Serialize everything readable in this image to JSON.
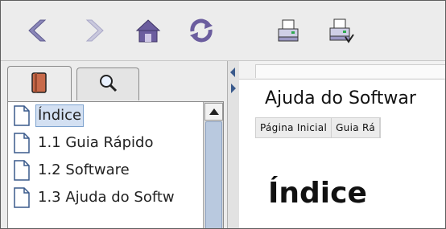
{
  "toolbar": {
    "icons": [
      "back-arrow-icon",
      "forward-arrow-icon",
      "home-icon",
      "sync-icon",
      "print-icon",
      "print-setup-icon"
    ]
  },
  "nav": {
    "tabs": [
      {
        "icon": "book-icon",
        "state": "selected"
      },
      {
        "icon": "magnifier-icon",
        "state": "unselected"
      }
    ],
    "items": [
      {
        "label": "Índice",
        "selected": true
      },
      {
        "label": "1.1 Guia Rápido",
        "selected": false
      },
      {
        "label": "1.2 Software",
        "selected": false
      },
      {
        "label": "1.3 Ajuda do Softw",
        "selected": false
      }
    ]
  },
  "content": {
    "doc_title": "Ajuda do Softwar",
    "links": [
      "Página Inicial",
      "Guia Rá"
    ],
    "heading": "Índice"
  },
  "colors": {
    "toolbar_bg": "#ececec",
    "arrow_purple": "#8a86b8",
    "home_purple": "#6b5d9e",
    "tab_book": "#c86a4a",
    "selection": "#d3e0f2"
  }
}
